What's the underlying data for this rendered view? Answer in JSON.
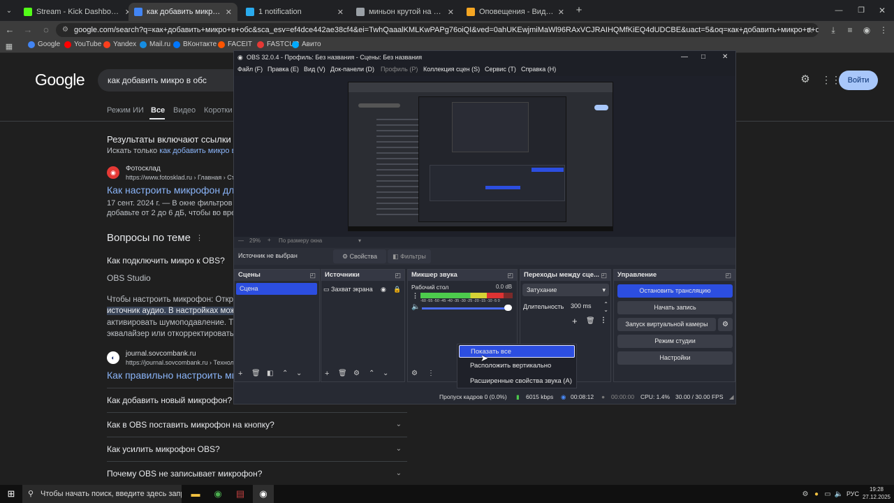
{
  "browser": {
    "tabs": [
      {
        "label": "Stream - Kick Dashboard",
        "icon": "kick-icon",
        "color": "#53fc18",
        "active": false
      },
      {
        "label": "как добавить микро в обс - Пои",
        "icon": "google-icon",
        "color": "#4285f4",
        "active": true
      },
      {
        "label": "1 notification",
        "icon": "telegram-icon",
        "color": "#2aabee",
        "active": false
      },
      {
        "label": "миньон крутой на гироскутере",
        "icon": "globe-icon",
        "color": "#9aa0a6",
        "active": false
      },
      {
        "label": "Оповещения - Виджеты - Dona",
        "icon": "donation-icon",
        "color": "#f5a623",
        "active": false
      }
    ],
    "url": "google.com/search?q=как+добавить+микро+в+обс&sca_esv=ef4dce442ae38cf4&ei=TwhQaaalKMLKwPAPg76oiQI&ved=0ahUKEwjmiMaWl96RAxVCJRAIHQMfKiEQ4dUDCBE&uact=5&oq=как+добавить+микро+в+обс&gs_lp=Egxnd3Mtd2l6LXNlcn",
    "bookmarks": [
      {
        "label": "Google",
        "color": "#4285f4"
      },
      {
        "label": "YouTube",
        "color": "#ff0000"
      },
      {
        "label": "Yandex",
        "color": "#fc3f1d"
      },
      {
        "label": "Mail.ru",
        "color": "#168de2"
      },
      {
        "label": "ВКонтакте",
        "color": "#0077ff"
      },
      {
        "label": "FACEIT",
        "color": "#ff5500"
      },
      {
        "label": "FASTCUP",
        "color": "#e53935"
      },
      {
        "label": "Авито",
        "color": "#00aaff"
      }
    ]
  },
  "google": {
    "logo": "Google",
    "query": "как добавить микро в обс",
    "nav": [
      "Режим ИИ",
      "Все",
      "Видео",
      "Коротки"
    ],
    "signin": "Войти",
    "notice_title": "Результаты включают ссылки по",
    "notice_sub_prefix": "Искать только ",
    "notice_sub_link": "как добавить микро в о",
    "r1_site": "Фотосклад",
    "r1_url": "https://www.fotosklad.ru › Главная › Статьи",
    "r1_title": "Как настроить микрофон для",
    "r1_snip1": "17 сент. 2024 г. — В окне фильтров нажми",
    "r1_snip2": "добавьте от 2 до 6 дБ, чтобы во время р",
    "paa_title": "Вопросы по теме",
    "paa_q1": "Как подключить микро к OBS?",
    "paa_a_source": "OBS Studio",
    "paa_a1": "Чтобы настроить микрофон: Откро",
    "paa_a2": "источник аудио. В настройках мож",
    "paa_a3": "активировать шумоподавление. Там",
    "paa_a4": "эквалайзер или откорректировать з",
    "r2_site": "journal.sovcombank.ru",
    "r2_url": "https://journal.sovcombank.ru › Технологии",
    "r2_title": "Как правильно настроить ми",
    "faqs": [
      "Как добавить новый микрофон?",
      "Как в OBS поставить микрофон на кнопку?",
      "Как усилить микрофон OBS?",
      "Почему OBS не записывает микрофон?"
    ]
  },
  "obs": {
    "title": "OBS 32.0.4 - Профиль: Без названия - Сцены: Без названия",
    "menu": [
      "Файл (F)",
      "Правка (E)",
      "Вид (V)",
      "Док-панели (D)",
      "Профиль (P)",
      "Коллекция сцен (S)",
      "Сервис (T)",
      "Справка (H)"
    ],
    "zoom": "29%",
    "zoom_mode": "По размеру окна",
    "no_source": "Источник не выбран",
    "properties": "Свойства",
    "filters": "Фильтры",
    "docks": {
      "scenes": "Сцены",
      "sources": "Источники",
      "mixer": "Микшер звука",
      "transitions": "Переходы между сце...",
      "controls": "Управление"
    },
    "scene_item": "Сцена",
    "source_item": "Захват экрана",
    "mixer_channel": "Рабочий стол",
    "mixer_db": "0.0 dB",
    "mixer_ticks": "-60 -55 -50 -45 -40 -35 -30 -25 -20 -15 -10 -5 0",
    "mixer_level": 0.9,
    "transition_type": "Затухание",
    "duration_label": "Длительность",
    "duration_value": "300 ms",
    "controls": [
      "Остановить трансляцию",
      "Начать запись",
      "Запуск виртуальной камеры",
      "Режим студии",
      "Настройки"
    ],
    "status": {
      "dropped": "Пропуск кадров 0 (0.0%)",
      "bitrate": "6015 kbps",
      "stream_time": "00:08:12",
      "rec_time": "00:00:00",
      "cpu": "CPU: 1.4%",
      "fps": "30.00 / 30.00 FPS"
    },
    "context_menu": [
      "Показать все",
      "Расположить вертикально",
      "Расширенные свойства звука (A)"
    ]
  },
  "taskbar": {
    "search_placeholder": "Чтобы начать поиск, введите здесь запрос",
    "lang": "РУС",
    "time": "19:28",
    "date": "27.12.2025"
  },
  "colors": {
    "obs_accent": "#2c4ee0",
    "link": "#8ab4f8"
  }
}
